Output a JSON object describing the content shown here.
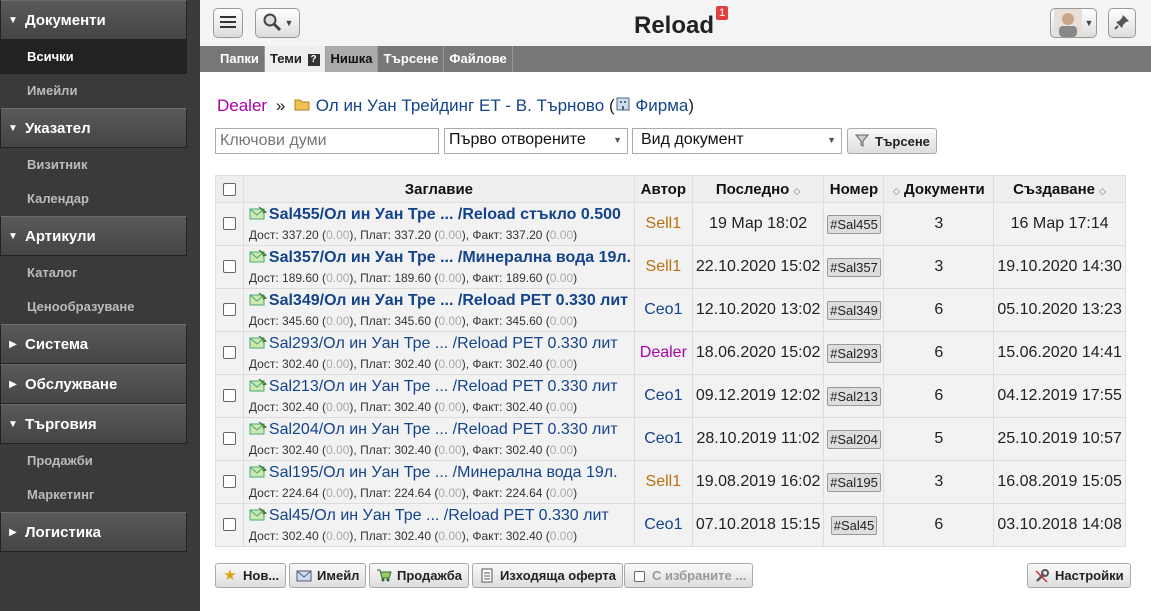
{
  "app": {
    "title": "Reload",
    "notifications": "1"
  },
  "sidebar": {
    "sections": [
      {
        "label": "Документи",
        "expanded": true,
        "items": [
          "Всички",
          "Имейли"
        ],
        "active_item": "Всички"
      },
      {
        "label": "Указател",
        "expanded": true,
        "items": [
          "Визитник",
          "Календар"
        ]
      },
      {
        "label": "Артикули",
        "expanded": true,
        "items": [
          "Каталог",
          "Ценообразуване"
        ]
      },
      {
        "label": "Система",
        "expanded": false,
        "items": []
      },
      {
        "label": "Обслужване",
        "expanded": false,
        "items": []
      },
      {
        "label": "Търговия",
        "expanded": true,
        "items": [
          "Продажби",
          "Маркетинг"
        ]
      },
      {
        "label": "Логистика",
        "expanded": false,
        "items": []
      }
    ]
  },
  "tabs": [
    {
      "label": "Папки"
    },
    {
      "label": "Теми",
      "help": "?"
    },
    {
      "label": "Нишка"
    },
    {
      "label": "Търсене"
    },
    {
      "label": "Файлове"
    }
  ],
  "breadcrumb": {
    "root": "Dealer",
    "sep": "»",
    "folder": "Ол ин Уан Трейдинг ЕТ - В. Търново",
    "open_paren": "(",
    "type": "Фирма",
    "close_paren": ")"
  },
  "filters": {
    "keywords_placeholder": "Ключови думи",
    "order_value": "Първо отворените",
    "doctype_value": "Вид документ",
    "search_button": "Търсене"
  },
  "table": {
    "headers": {
      "title": "Заглавие",
      "author": "Автор",
      "last": "Последно",
      "number": "Номер",
      "docs": "Документи",
      "created": "Създаване"
    },
    "rows": [
      {
        "title": "Sal455/Ол ин Уан Тре ... /Reload стъкло 0.500",
        "bold": true,
        "deliv": "337.20",
        "paid": "337.20",
        "inv": "337.20",
        "zero": "0.00",
        "author": "Sell1",
        "author_kind": "sell",
        "last": "19 Мар 18:02",
        "number": "#Sal455",
        "docs": "3",
        "created": "16 Мар 17:14"
      },
      {
        "title": "Sal357/Ол ин Уан Тре ... /Минерална вода 19л.",
        "bold": true,
        "deliv": "189.60",
        "paid": "189.60",
        "inv": "189.60",
        "zero": "0.00",
        "author": "Sell1",
        "author_kind": "sell",
        "last": "22.10.2020 15:02",
        "number": "#Sal357",
        "docs": "3",
        "created": "19.10.2020 14:30"
      },
      {
        "title": "Sal349/Ол ин Уан Тре ... /Reload PET 0.330 лит",
        "bold": true,
        "deliv": "345.60",
        "paid": "345.60",
        "inv": "345.60",
        "zero": "0.00",
        "author": "Ceo1",
        "author_kind": "ceo",
        "last": "12.10.2020 13:02",
        "number": "#Sal349",
        "docs": "6",
        "created": "05.10.2020 13:23"
      },
      {
        "title": "Sal293/Ол ин Уан Тре ... /Reload PET 0.330 лит",
        "bold": false,
        "deliv": "302.40",
        "paid": "302.40",
        "inv": "302.40",
        "zero": "0.00",
        "author": "Dealer",
        "author_kind": "dealer",
        "last": "18.06.2020 15:02",
        "number": "#Sal293",
        "docs": "6",
        "created": "15.06.2020 14:41"
      },
      {
        "title": "Sal213/Ол ин Уан Тре ... /Reload PET 0.330 лит",
        "bold": false,
        "deliv": "302.40",
        "paid": "302.40",
        "inv": "302.40",
        "zero": "0.00",
        "author": "Ceo1",
        "author_kind": "ceo",
        "last": "09.12.2019 12:02",
        "number": "#Sal213",
        "docs": "6",
        "created": "04.12.2019 17:55"
      },
      {
        "title": "Sal204/Ол ин Уан Тре ... /Reload PET 0.330 лит",
        "bold": false,
        "deliv": "302.40",
        "paid": "302.40",
        "inv": "302.40",
        "zero": "0.00",
        "author": "Ceo1",
        "author_kind": "ceo",
        "last": "28.10.2019 11:02",
        "number": "#Sal204",
        "docs": "5",
        "created": "25.10.2019 10:57"
      },
      {
        "title": "Sal195/Ол ин Уан Тре ... /Минерална вода 19л.",
        "bold": false,
        "deliv": "224.64",
        "paid": "224.64",
        "inv": "224.64",
        "zero": "0.00",
        "author": "Sell1",
        "author_kind": "sell",
        "last": "19.08.2019 16:02",
        "number": "#Sal195",
        "docs": "3",
        "created": "16.08.2019 15:05"
      },
      {
        "title": "Sal45/Ол ин Уан Тре ... /Reload PET 0.330 лит",
        "bold": false,
        "deliv": "302.40",
        "paid": "302.40",
        "inv": "302.40",
        "zero": "0.00",
        "author": "Ceo1",
        "author_kind": "ceo",
        "last": "07.10.2018 15:15",
        "number": "#Sal45",
        "docs": "6",
        "created": "03.10.2018 14:08"
      }
    ],
    "sub_labels": {
      "deliv": "Дост:",
      "paid": "Плат:",
      "inv": "Факт:"
    }
  },
  "actions": {
    "new": "Нов...",
    "email": "Имейл",
    "sale": "Продажба",
    "offer": "Изходяща оферта",
    "selected": "С избраните ...",
    "settings": "Настройки"
  },
  "colors": {
    "sidebar_bg": "#3a3a3a",
    "link": "#13438a",
    "dealer": "#aa00aa",
    "seller": "#b8710e",
    "badge": "#e04040"
  }
}
